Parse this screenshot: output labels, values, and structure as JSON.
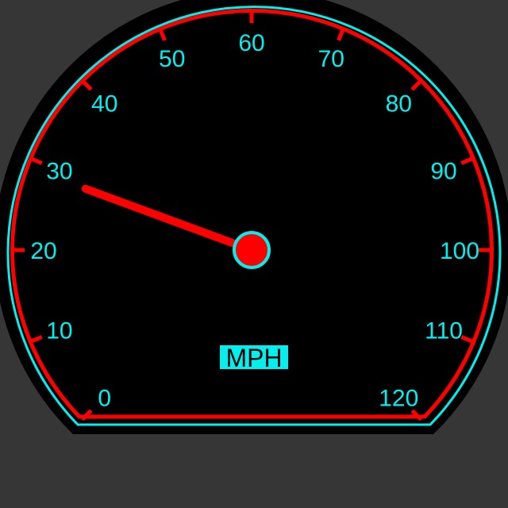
{
  "gauge": {
    "unit": "MPH",
    "min": 0,
    "max": 120,
    "major_step": 10,
    "value": 29,
    "tick_labels": [
      "0",
      "10",
      "20",
      "30",
      "40",
      "50",
      "60",
      "70",
      "80",
      "90",
      "100",
      "110",
      "120"
    ]
  },
  "colors": {
    "background": "#363636",
    "face": "#000000",
    "bezel_outer": "#000000",
    "rim": "#ff0000",
    "accent": "#00f0f0",
    "needle": "#ff0000",
    "unit_box_bg": "#00f0f0",
    "unit_text": "#000000"
  }
}
